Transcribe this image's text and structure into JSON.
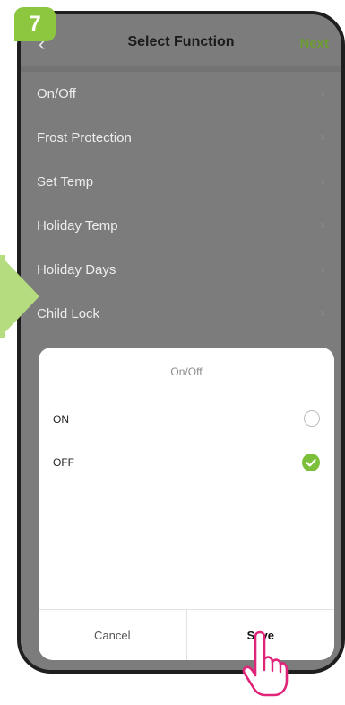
{
  "step_badge": "7",
  "header": {
    "back_icon": "chevron-left-icon",
    "title": "Select Function",
    "next_label": "Next"
  },
  "functions": [
    {
      "label": "On/Off"
    },
    {
      "label": "Frost Protection"
    },
    {
      "label": "Set Temp"
    },
    {
      "label": "Holiday Temp"
    },
    {
      "label": "Holiday Days"
    },
    {
      "label": "Child Lock"
    }
  ],
  "sheet": {
    "title": "On/Off",
    "options": [
      {
        "label": "ON",
        "selected": false
      },
      {
        "label": "OFF",
        "selected": true
      }
    ],
    "cancel_label": "Cancel",
    "save_label": "Save"
  },
  "colors": {
    "accent_green": "#8dc63f",
    "check_green": "#7cbf3a",
    "next_green": "#6f9b33"
  }
}
